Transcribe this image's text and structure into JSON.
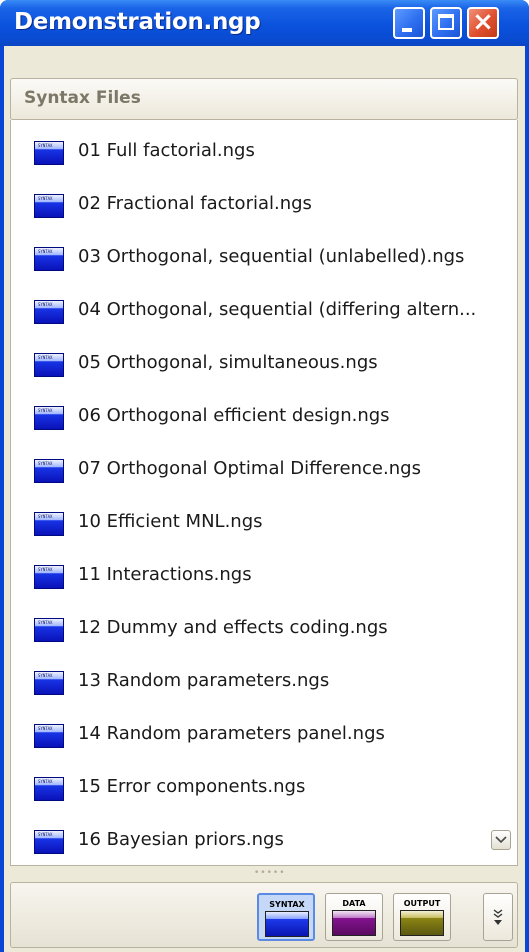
{
  "window": {
    "title": "Demonstration.ngp"
  },
  "section": {
    "label": "Syntax Files"
  },
  "files": [
    {
      "icon": "syntax-file-icon",
      "name": "01 Full factorial.ngs"
    },
    {
      "icon": "syntax-file-icon",
      "name": "02 Fractional factorial.ngs"
    },
    {
      "icon": "syntax-file-icon",
      "name": "03 Orthogonal, sequential (unlabelled).ngs"
    },
    {
      "icon": "syntax-file-icon",
      "name": "04 Orthogonal, sequential (differing altern..."
    },
    {
      "icon": "syntax-file-icon",
      "name": "05 Orthogonal, simultaneous.ngs"
    },
    {
      "icon": "syntax-file-icon",
      "name": "06 Orthogonal efficient design.ngs"
    },
    {
      "icon": "syntax-file-icon",
      "name": "07 Orthogonal Optimal Difference.ngs"
    },
    {
      "icon": "syntax-file-icon",
      "name": "10 Efficient MNL.ngs"
    },
    {
      "icon": "syntax-file-icon",
      "name": "11 Interactions.ngs"
    },
    {
      "icon": "syntax-file-icon",
      "name": "12 Dummy and effects coding.ngs"
    },
    {
      "icon": "syntax-file-icon",
      "name": "13 Random parameters.ngs"
    },
    {
      "icon": "syntax-file-icon",
      "name": "14 Random parameters panel.ngs"
    },
    {
      "icon": "syntax-file-icon",
      "name": "15 Error components.ngs"
    },
    {
      "icon": "syntax-file-icon",
      "name": "16 Bayesian priors.ngs"
    }
  ],
  "icon_tag": "SYNTAX",
  "view_buttons": [
    {
      "label": "SYNTAX",
      "color": "#1d39ea",
      "selected": true
    },
    {
      "label": "DATA",
      "color": "#84128f",
      "selected": false
    },
    {
      "label": "OUTPUT",
      "color": "#8b8414",
      "selected": false
    }
  ],
  "colors": {
    "title_bar": "#0a52dc",
    "close_button": "#e0502e",
    "panel_bg": "#ece9d8"
  }
}
